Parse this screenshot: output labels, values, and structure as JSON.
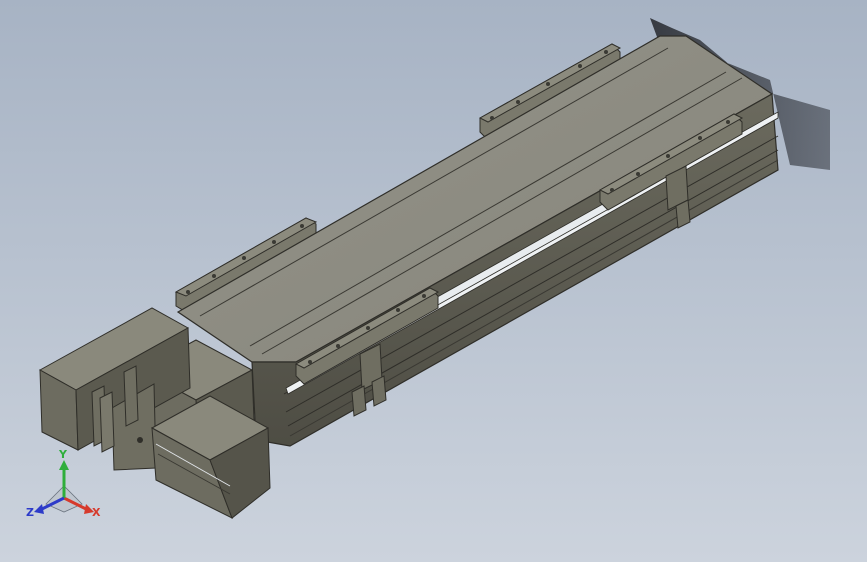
{
  "viewport": {
    "background_top": "#a7b3c4",
    "background_bottom": "#ccd3dd"
  },
  "model": {
    "body_color": "#7c7b6d",
    "top_color": "#8f8e80",
    "dark_face_color": "#555348",
    "rail_color": "#e8ecef",
    "hole_color": "#3a3a34"
  },
  "triad": {
    "x_label": "X",
    "y_label": "Y",
    "z_label": "Z",
    "x_color": "#d63a2c",
    "y_color": "#2fae3b",
    "z_color": "#2d3bc9"
  }
}
